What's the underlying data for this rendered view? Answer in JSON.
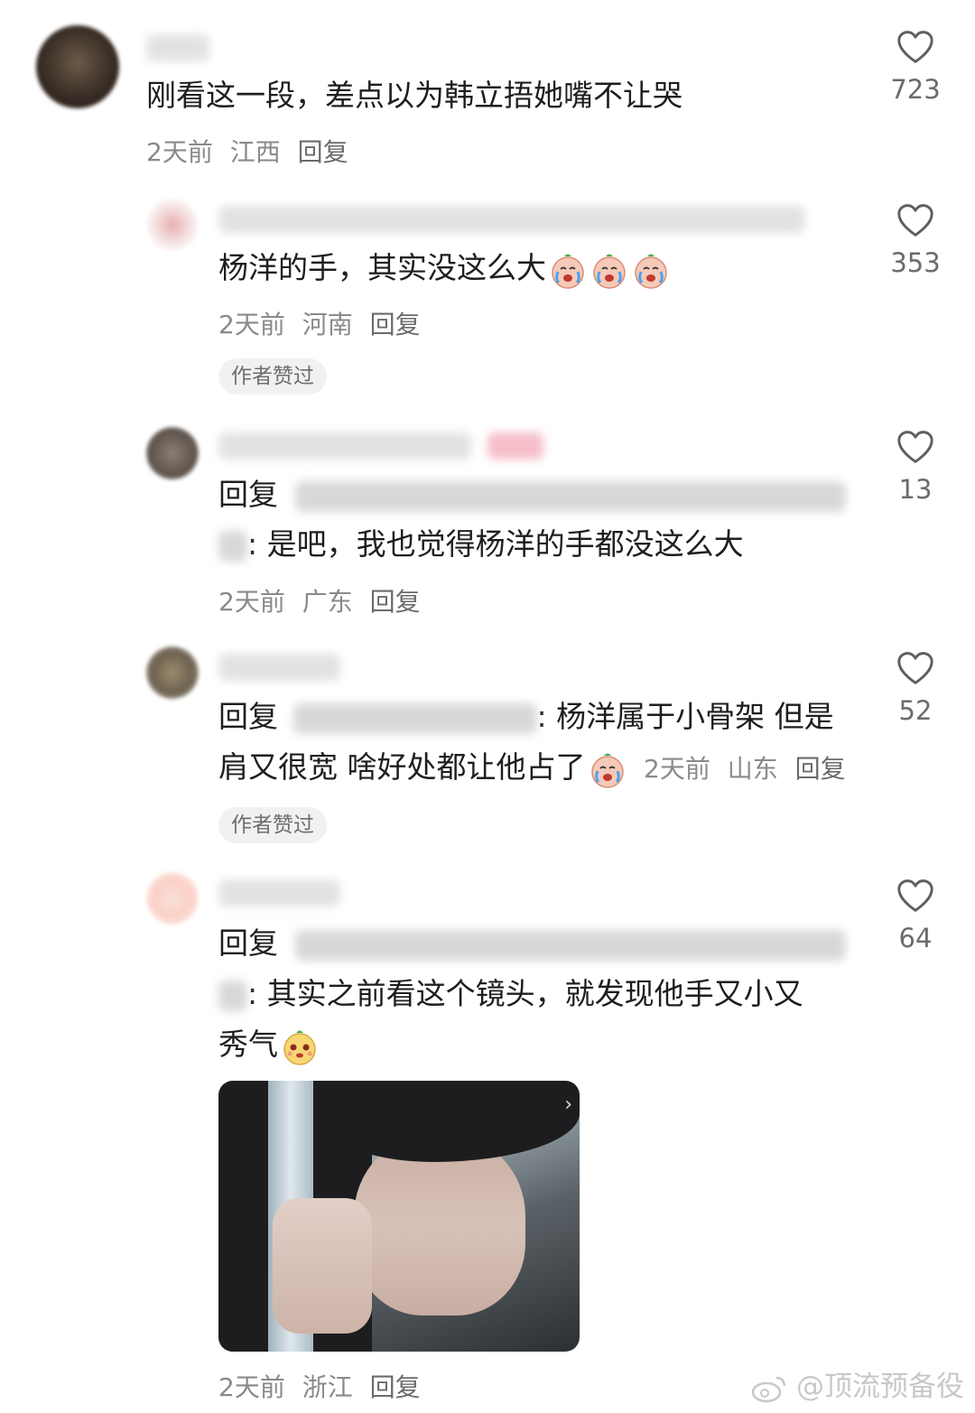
{
  "comments": [
    {
      "text": "刚看这一段，差点以为韩立捂她嘴不让哭",
      "time": "2天前",
      "location": "江西",
      "reply_label": "回复",
      "likes": "723"
    },
    {
      "text": "杨洋的手，其实没这么大",
      "time": "2天前",
      "location": "河南",
      "reply_label": "回复",
      "likes": "353",
      "badge": "作者赞过",
      "emoji": "crying-face-emoji"
    },
    {
      "reply_prefix": "回复",
      "line2_rest": ": 是吧，我也觉得杨洋的手都没这么大",
      "time": "2天前",
      "location": "广东",
      "reply_label": "回复",
      "likes": "13"
    },
    {
      "reply_prefix": "回复",
      "line1_rest": ": 杨洋属于小骨架 但是",
      "line2": "肩又很宽 啥好处都让他占了",
      "time": "2天前",
      "location": "山东",
      "reply_label": "回复",
      "likes": "52",
      "badge": "作者赞过",
      "emoji": "crying-face-emoji"
    },
    {
      "reply_prefix": "回复",
      "line2_rest": ": 其实之前看这个镜头，就发现他手又小又",
      "line3": "秀气",
      "time": "2天前",
      "location": "浙江",
      "reply_label": "回复",
      "likes": "64",
      "emoji": "cute-face-emoji"
    }
  ],
  "watermark": {
    "text": "@顶流预备役",
    "icon": "weibo-icon"
  }
}
